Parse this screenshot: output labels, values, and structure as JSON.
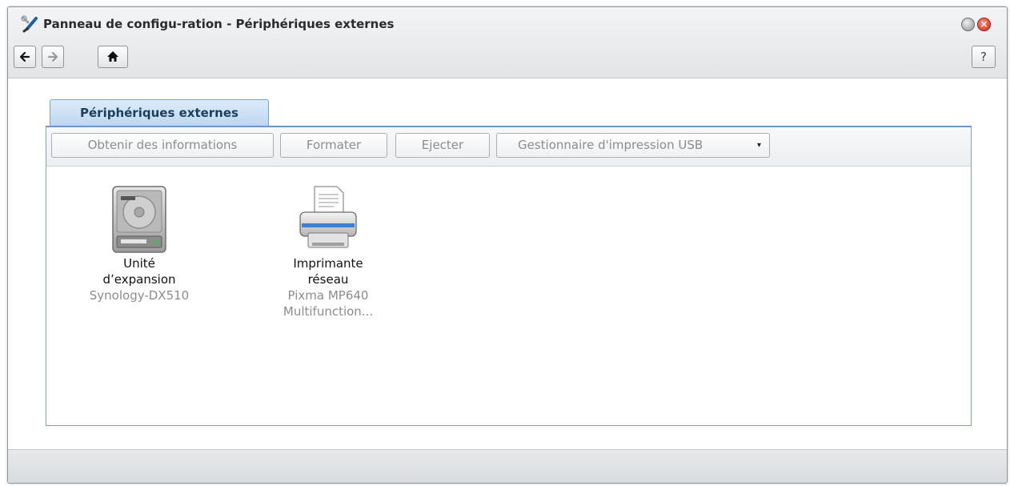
{
  "window": {
    "title": "Panneau de configu-ration - Périphériques externes",
    "app_icon": "wrench-screwdriver-icon",
    "help_label": "?",
    "close_label": "×"
  },
  "nav": {
    "back_icon": "arrow-left-icon",
    "forward_icon": "arrow-right-icon",
    "home_icon": "home-icon"
  },
  "tab": {
    "label": "Périphériques externes"
  },
  "toolbar": {
    "info_label": "Obtenir des informations",
    "format_label": "Formater",
    "eject_label": "Ejecter",
    "usb_label": "Gestionnaire d'impression USB",
    "caret": "▾"
  },
  "devices": [
    {
      "icon": "hard-drive-icon",
      "name_line1": "Unité",
      "name_line2": "d’expansion",
      "model_line1": "Synology-DX510",
      "model_line2": ""
    },
    {
      "icon": "printer-icon",
      "name_line1": "Imprimante",
      "name_line2": "réseau",
      "model_line1": "Pixma MP640",
      "model_line2": "Multifunction..."
    }
  ],
  "colors": {
    "tab_accent": "#bcd6ee",
    "close_button": "#d22b1c",
    "disabled_text": "#8a8e93"
  }
}
